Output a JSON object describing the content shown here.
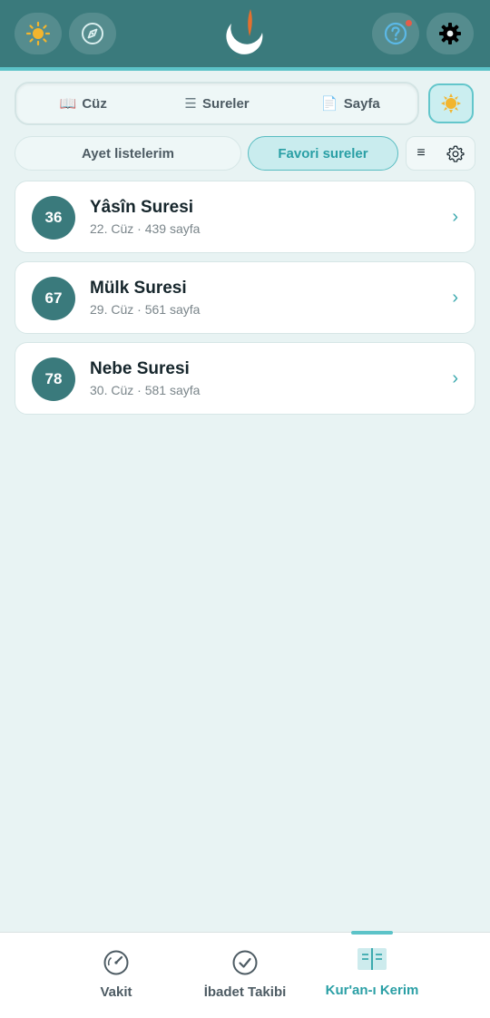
{
  "header": {
    "left_icons": [
      "sun-icon",
      "compass-icon"
    ],
    "right_icons": [
      "help-icon",
      "gear-icon"
    ],
    "logo": "crescent-logo",
    "colors": {
      "bar": "#3a7a7c",
      "accent": "#5cc3c8",
      "notification": "#e35d4a"
    }
  },
  "segments": {
    "tabs": [
      {
        "icon": "📖",
        "label": "Cüz"
      },
      {
        "icon": "☰",
        "label": "Sureler"
      },
      {
        "icon": "📄",
        "label": "Sayfa"
      }
    ],
    "theme_icon": "sun-icon"
  },
  "filters": {
    "ayet": "Ayet listelerim",
    "favori": "Favori sureler",
    "list_icon": "≡",
    "settings_icon": "gear-icon"
  },
  "surahs": [
    {
      "number": "36",
      "name": "Yâsîn Suresi",
      "detail": "22. Cüz · 439 sayfa",
      "chevron": "›"
    },
    {
      "number": "67",
      "name": "Mülk Suresi",
      "detail": "29. Cüz · 561 sayfa",
      "chevron": "›"
    },
    {
      "number": "78",
      "name": "Nebe Suresi",
      "detail": "30. Cüz · 581 sayfa",
      "chevron": "›"
    }
  ],
  "bottom_nav": {
    "items": [
      {
        "label": "Vakit",
        "icon": "gauge-icon"
      },
      {
        "label": "İbadet Takibi",
        "icon": "check-circle-icon"
      },
      {
        "label": "Kur'an-ı Kerim",
        "icon": "book-icon",
        "active": true
      }
    ],
    "colors": {
      "active": "#2a9fa5",
      "inactive": "#4d5b63"
    }
  }
}
